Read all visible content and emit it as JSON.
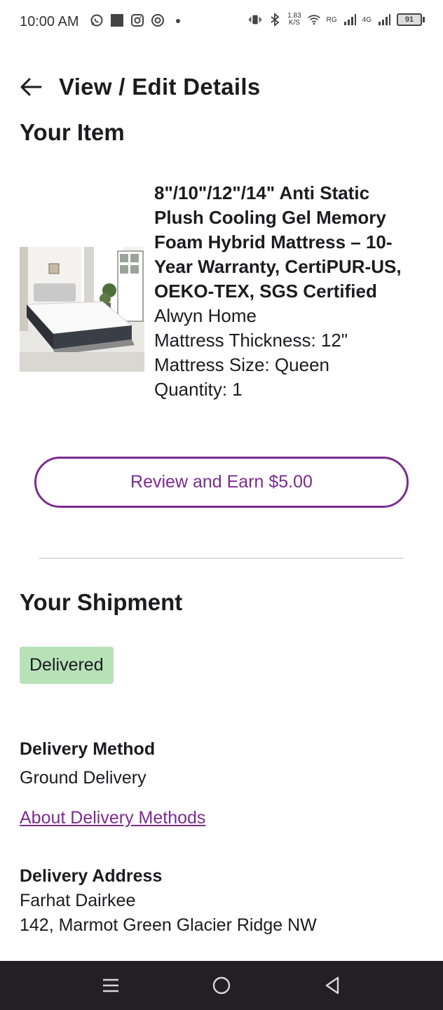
{
  "status_bar": {
    "time": "10:00 AM",
    "left_icons": [
      "whatsapp-icon",
      "square-icon",
      "instagram-icon",
      "threads-icon",
      "dot-icon"
    ],
    "net_speed_value": "1.83",
    "net_speed_unit": "K/S",
    "carrier_a": "RG",
    "carrier_b": "4G",
    "battery_level": "91"
  },
  "header": {
    "back_icon": "arrow-left-icon",
    "title": "View / Edit Details"
  },
  "item_section": {
    "title": "Your Item",
    "name": "8\"/10\"/12\"/14\" Anti Static Plush Cooling Gel Memory Foam Hybrid Mattress – 10-Year Warranty, CertiPUR-US, OEKO-TEX, SGS Certified",
    "brand": "Alwyn Home",
    "thickness": "Mattress Thickness: 12\"",
    "size": "Mattress Size: Queen",
    "quantity": "Quantity: 1",
    "review_button": "Review and Earn $5.00"
  },
  "shipment_section": {
    "title": "Your Shipment",
    "status": "Delivered",
    "delivery_method_label": "Delivery Method",
    "delivery_method_value": "Ground Delivery",
    "about_link": "About Delivery Methods",
    "delivery_address_label": "Delivery Address",
    "address_name": "Farhat Dairkee",
    "address_line": "142, Marmot Green Glacier Ridge NW"
  },
  "nav_bar": {
    "buttons": [
      "menu-icon",
      "home-circle-icon",
      "back-triangle-icon"
    ]
  },
  "colors": {
    "accent": "#7b2c8f",
    "delivered_badge": "#b7e2b7",
    "nav_bar": "#232024"
  }
}
